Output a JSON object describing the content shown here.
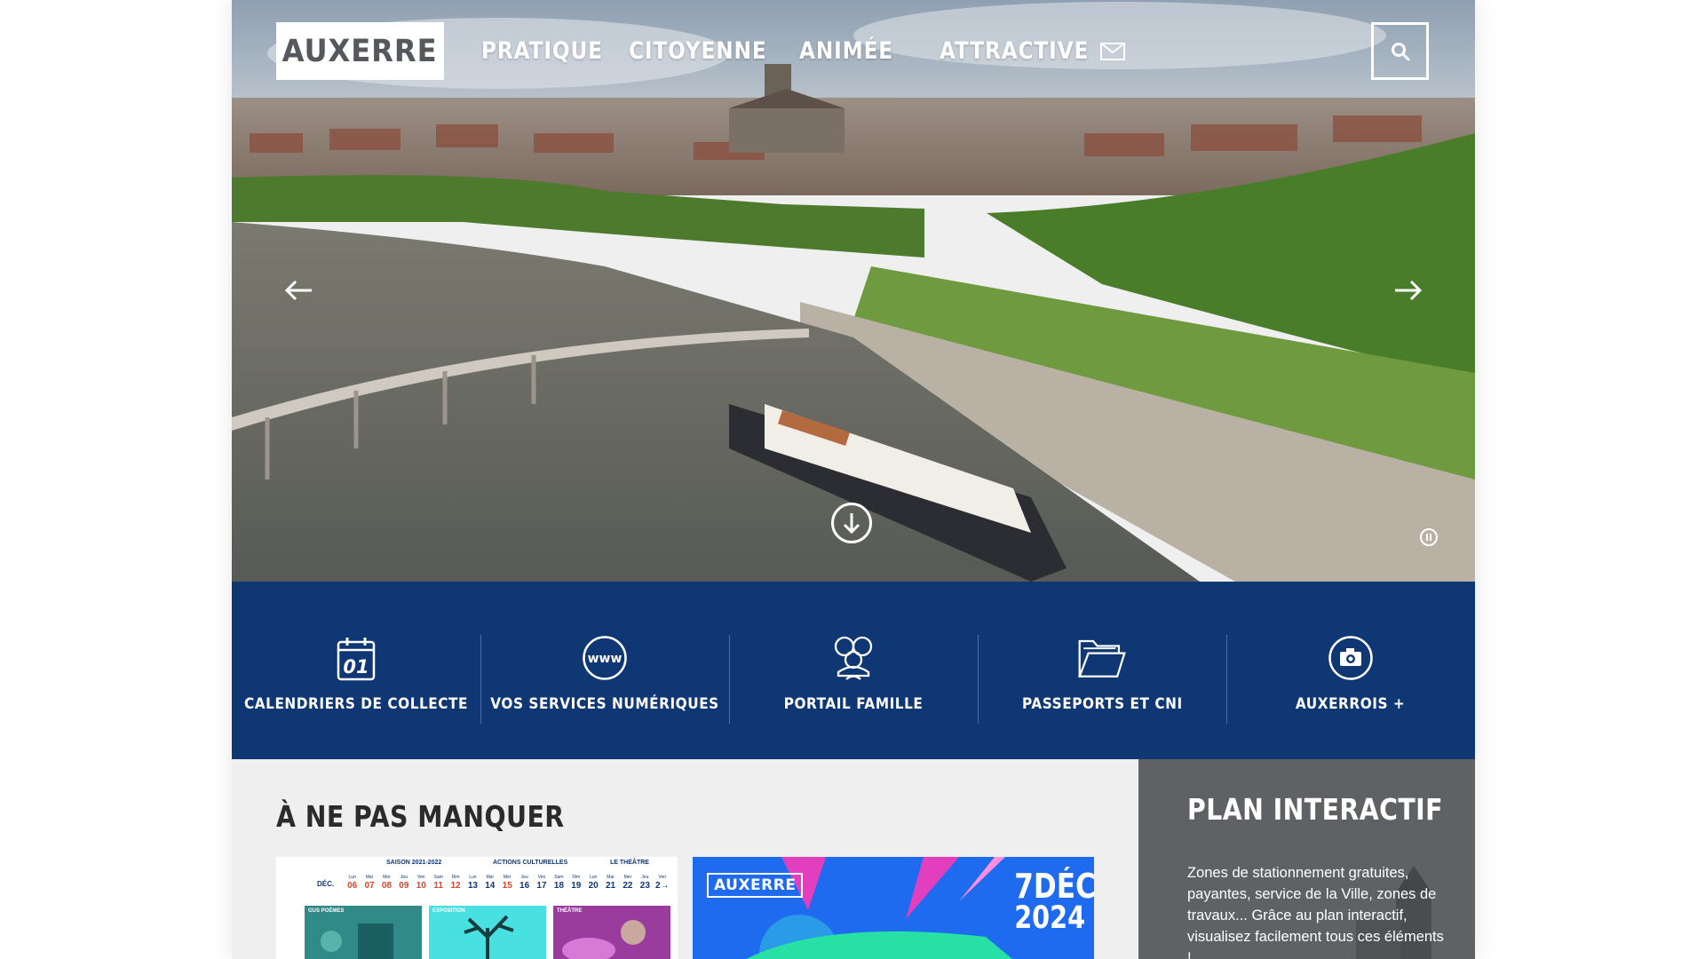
{
  "header": {
    "logo_text": "AUXERRE",
    "nav": [
      {
        "label": "PRATIQUE"
      },
      {
        "label": "CITOYENNE"
      },
      {
        "label": "ANIMÉE"
      },
      {
        "label": "ATTRACTIVE"
      }
    ],
    "mail_icon": "envelope-icon",
    "search_icon": "search-icon"
  },
  "hero": {
    "prev_icon": "arrow-left-icon",
    "next_icon": "arrow-right-icon",
    "scroll_icon": "arrow-down-circle-icon",
    "pause_icon": "pause-icon"
  },
  "quick_links": [
    {
      "label": "CALENDRIERS DE COLLECTE",
      "icon": "calendar-icon",
      "icon_text": "01"
    },
    {
      "label": "VOS SERVICES NUMÉRIQUES",
      "icon": "www-globe-icon",
      "icon_text": "www"
    },
    {
      "label": "PORTAIL FAMILLE",
      "icon": "family-icon"
    },
    {
      "label": "PASSEPORTS ET CNI",
      "icon": "folder-icon"
    },
    {
      "label": "AUXERROIS +",
      "icon": "camera-icon"
    }
  ],
  "highlights": {
    "title": "À NE PAS MANQUER",
    "card1": {
      "header_left": "SAISON 2021-2022",
      "header_mid": "ACTIONS CULTURELLES",
      "header_right": "LE THÉÂTRE",
      "month": "DÉC.",
      "days": [
        {
          "d": "Lun",
          "n": "06"
        },
        {
          "d": "Mar",
          "n": "07"
        },
        {
          "d": "Mer",
          "n": "08"
        },
        {
          "d": "Jeu",
          "n": "09"
        },
        {
          "d": "Ven",
          "n": "10"
        },
        {
          "d": "Sam",
          "n": "11"
        },
        {
          "d": "Dim",
          "n": "12"
        },
        {
          "d": "Lun",
          "n": "13"
        },
        {
          "d": "Mar",
          "n": "14"
        },
        {
          "d": "Mer",
          "n": "15"
        },
        {
          "d": "Jeu",
          "n": "16"
        },
        {
          "d": "Ven",
          "n": "17"
        },
        {
          "d": "Sam",
          "n": "18"
        },
        {
          "d": "Dim",
          "n": "19"
        },
        {
          "d": "Lun",
          "n": "20"
        },
        {
          "d": "Mar",
          "n": "21"
        },
        {
          "d": "Mer",
          "n": "22"
        },
        {
          "d": "Jeu",
          "n": "23"
        },
        {
          "d": "Ven",
          "n": "2→"
        }
      ],
      "thumb_captions": [
        "GUS POÈMES",
        "EXPOSITION",
        "THÉÂTRE"
      ]
    },
    "card2": {
      "logo": "AUXERRE",
      "date_line1": "7DÉC",
      "date_line2": "2024"
    }
  },
  "plan": {
    "title": "PLAN INTERACTIF",
    "text": "Zones de stationnement gratuites, payantes, service de la Ville, zones de travaux... Grâce au plan interactif, visualisez facilement tous ces éléments !"
  },
  "colors": {
    "brand_blue": "#0e3774",
    "panel_gray": "#efefef",
    "plan_bg": "#5b5d60",
    "card2_blue": "#1f6bf0"
  }
}
